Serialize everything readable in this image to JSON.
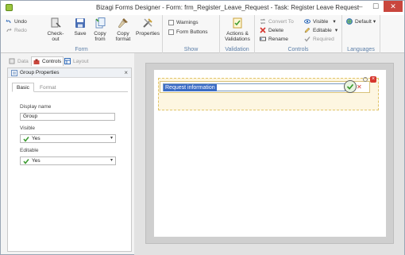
{
  "window": {
    "title": "Bizagi Forms Designer  - Form: frm_Register_Leave_Request - Task: Register Leave Request",
    "min_symbol": "–",
    "max_symbol": "☐",
    "close_symbol": "✕"
  },
  "ribbon": {
    "form_group": {
      "label": "Form",
      "undo": "Undo",
      "redo": "Redo",
      "checkout": "Check-out",
      "save": "Save",
      "copy_from": "Copy from",
      "copy_format": "Copy format",
      "properties": "Properties"
    },
    "show_group": {
      "label": "Show",
      "warnings": "Warnings",
      "form_buttons": "Form Buttons"
    },
    "validation_group": {
      "label": "Validation",
      "actions_validations": "Actions & Validations"
    },
    "controls_group": {
      "label": "Controls",
      "convert_to": "Convert To",
      "delete": "Delete",
      "rename": "Rename",
      "visible": "Visible",
      "editable": "Editable",
      "required": "Required"
    },
    "languages_group": {
      "label": "Languages",
      "default": "Default"
    }
  },
  "left_tabs": {
    "data": "Data",
    "controls": "Controls",
    "layout": "Layout"
  },
  "properties_panel": {
    "title": "Group Properties",
    "close": "×",
    "tabs": [
      "Basic",
      "Format"
    ],
    "display_name_label": "Display name",
    "display_name_value": "Group",
    "visible_label": "Visible",
    "visible_value": "Yes",
    "editable_label": "Editable",
    "editable_value": "Yes"
  },
  "canvas": {
    "group_title_value": "Request information",
    "delete_symbol": "×"
  },
  "colors": {
    "accent_blue": "#3b6cc5",
    "group_fill": "#fdf6e1",
    "delete_red": "#d6362f",
    "check_green": "#3a9a2f"
  }
}
